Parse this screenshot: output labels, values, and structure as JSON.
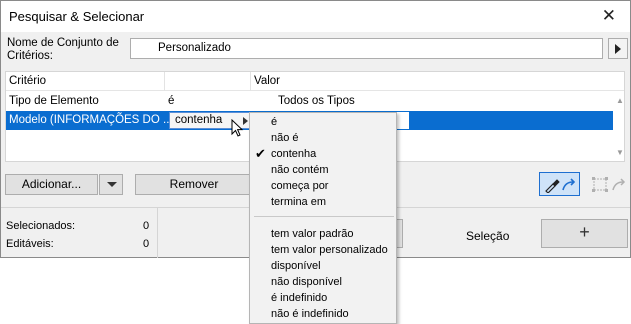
{
  "window": {
    "title": "Pesquisar & Selecionar",
    "close_glyph": "✕"
  },
  "criteria_set": {
    "label_line1": "Nome de Conjunto de",
    "label_line2": "Critérios:",
    "value": "Personalizado"
  },
  "table": {
    "headers": {
      "criterion": "Critério",
      "operator": "",
      "value": "Valor"
    },
    "rows": [
      {
        "criterion": "Tipo de Elemento",
        "operator": "é",
        "value": "Todos os Tipos",
        "selected": false
      },
      {
        "criterion": "Modelo (INFORMAÇÕES DO ...",
        "operator": "contenha",
        "value": "",
        "selected": true
      }
    ]
  },
  "buttons": {
    "add": "Adicionar...",
    "remove": "Remover",
    "plus": "+"
  },
  "stats": {
    "selected_label": "Selecionados:",
    "selected_value": "0",
    "editable_label": "Editáveis:",
    "editable_value": "0"
  },
  "selection_label": "Seleção",
  "operator_menu": {
    "group1": [
      "é",
      "não é",
      "contenha",
      "não contém",
      "começa por",
      "termina em"
    ],
    "group2": [
      "tem valor padrão",
      "tem valor personalizado",
      "disponível",
      "não disponível",
      "é indefinido",
      "não é indefinido"
    ],
    "checked": "contenha",
    "check_glyph": "✔"
  },
  "icons": {
    "set_dropdown": "triangle-right-icon",
    "pick_parameter": "eyedropper-icon",
    "pick_disabled": "marquee-select-icon",
    "cursor": "mouse-pointer-icon"
  },
  "colors": {
    "selection_bg": "#0a6dd0",
    "accent_border": "#1e6fd0",
    "tool_active_bg": "#cfe3f8"
  }
}
